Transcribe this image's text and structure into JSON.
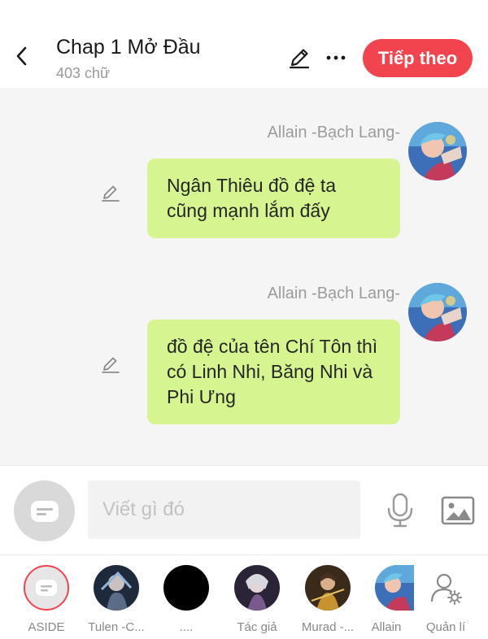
{
  "header": {
    "title": "Chap 1 Mở Đầu",
    "word_count": "403 chữ",
    "next_label": "Tiếp theo",
    "icons": {
      "back": "chevron-left-icon",
      "edit": "pencil-icon",
      "more": "more-horizontal-icon"
    }
  },
  "messages": [
    {
      "author": "Allain -Bạch Lang-",
      "text": "Ngân Thiêu đồ đệ ta cũng mạnh lắm đấy"
    },
    {
      "author": "Allain -Bạch Lang-",
      "text": "đồ đệ của tên Chí Tôn thì có Linh Nhi, Băng Nhi và Phi Ưng"
    }
  ],
  "composer": {
    "placeholder": "Viết gì đó",
    "icons": {
      "toggle": "chat-bubble-icon",
      "mic": "microphone-icon",
      "image": "image-icon"
    }
  },
  "characters": [
    {
      "name": "ASIDE"
    },
    {
      "name": "Tulen -C..."
    },
    {
      "name": "...."
    },
    {
      "name": "Tác giả"
    },
    {
      "name": "Murad -..."
    },
    {
      "name": "Allain"
    },
    {
      "name": "Quản lí"
    }
  ],
  "colors": {
    "accent": "#f2444e",
    "bubble": "#d6f590",
    "chat_background": "#f5f5f5"
  }
}
